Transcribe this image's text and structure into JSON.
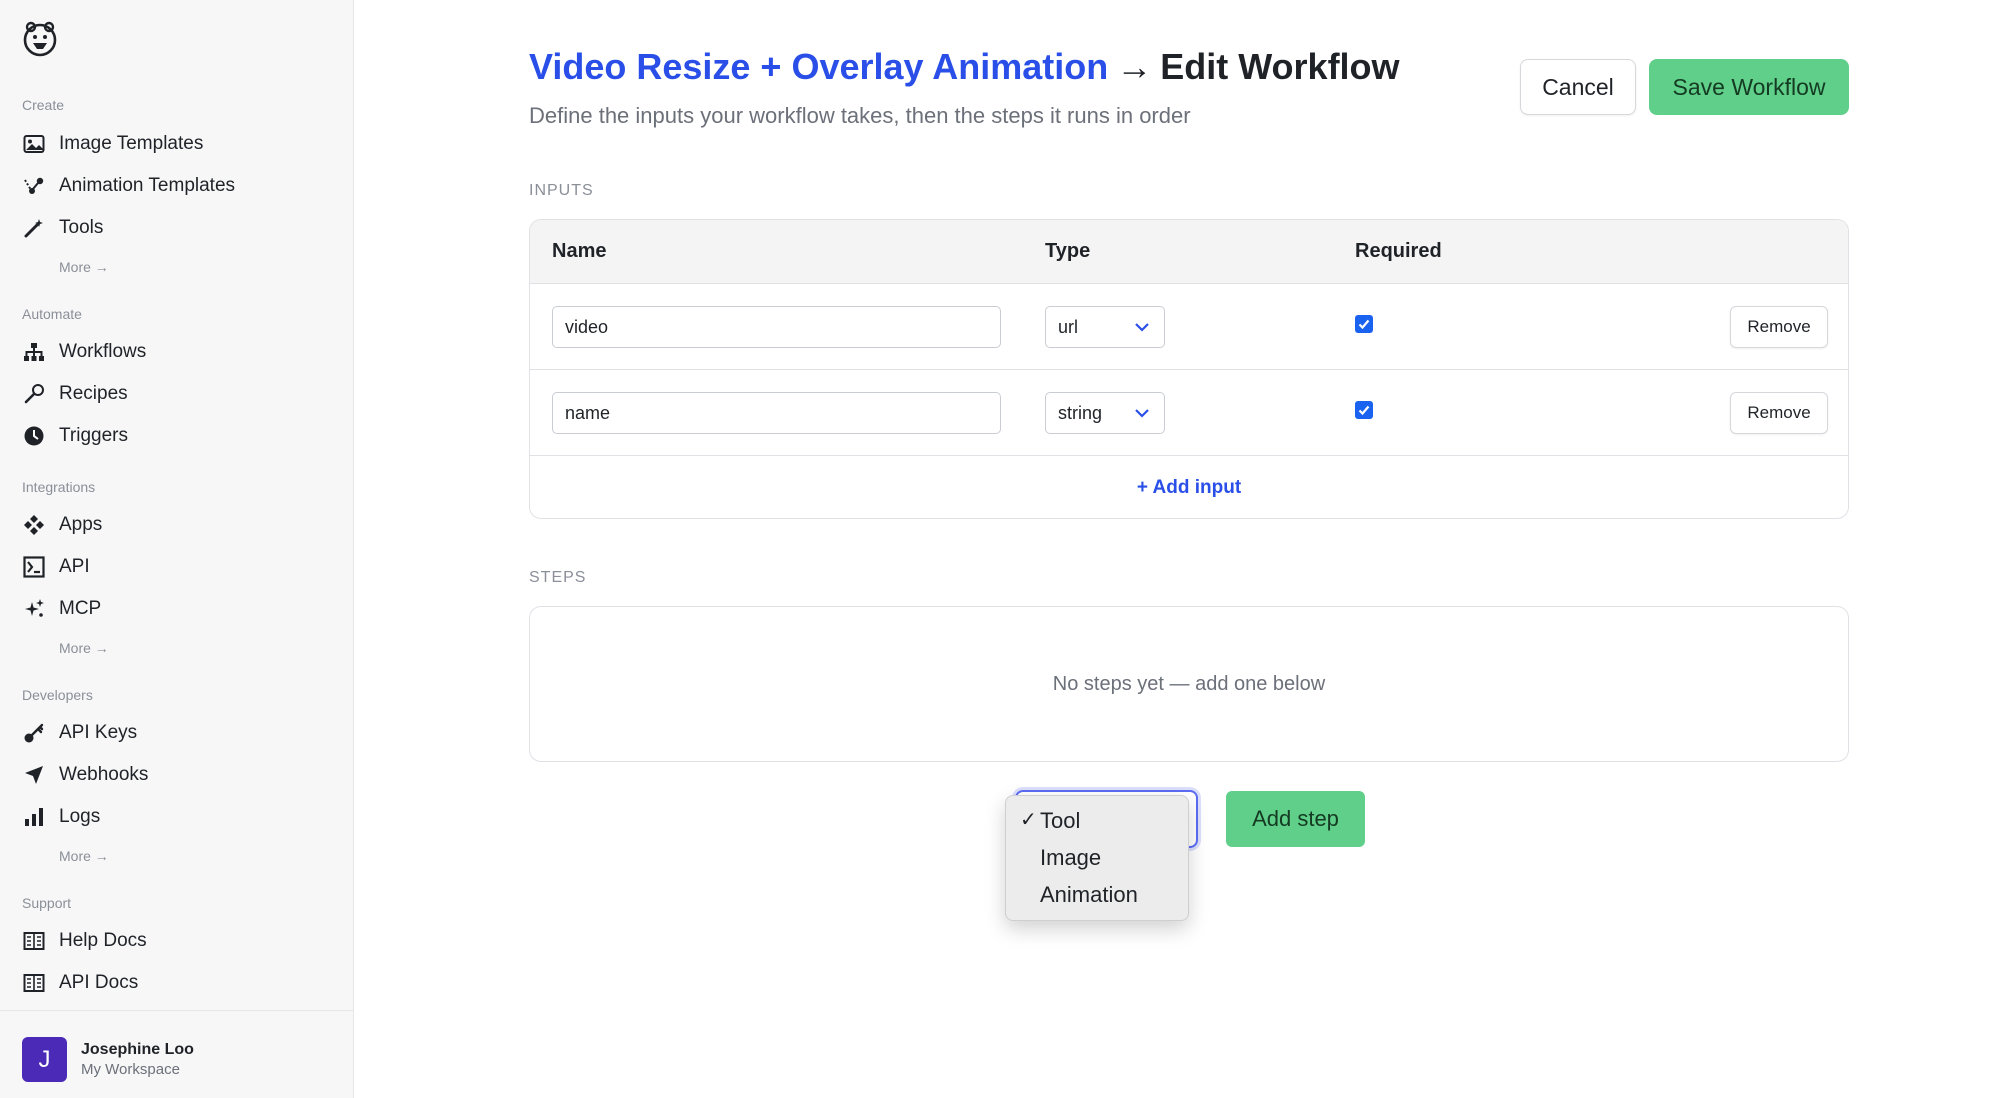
{
  "sidebar": {
    "sections": [
      {
        "label": "Create",
        "items": [
          {
            "label": "Image Templates",
            "icon": "image-icon"
          },
          {
            "label": "Animation Templates",
            "icon": "animation-icon"
          },
          {
            "label": "Tools",
            "icon": "magic-wand-icon"
          }
        ],
        "more": "More →"
      },
      {
        "label": "Automate",
        "items": [
          {
            "label": "Workflows",
            "icon": "workflow-icon"
          },
          {
            "label": "Recipes",
            "icon": "recipe-icon"
          },
          {
            "label": "Triggers",
            "icon": "clock-icon"
          }
        ]
      },
      {
        "label": "Integrations",
        "items": [
          {
            "label": "Apps",
            "icon": "apps-icon"
          },
          {
            "label": "API",
            "icon": "terminal-icon"
          },
          {
            "label": "MCP",
            "icon": "sparkle-icon"
          }
        ],
        "more": "More →"
      },
      {
        "label": "Developers",
        "items": [
          {
            "label": "API Keys",
            "icon": "key-icon"
          },
          {
            "label": "Webhooks",
            "icon": "send-icon"
          },
          {
            "label": "Logs",
            "icon": "bar-chart-icon"
          }
        ],
        "more": "More →"
      },
      {
        "label": "Support",
        "items": [
          {
            "label": "Help Docs",
            "icon": "book-icon"
          },
          {
            "label": "API Docs",
            "icon": "book-icon"
          }
        ]
      }
    ],
    "user": {
      "initial": "J",
      "name": "Josephine Loo",
      "workspace": "My Workspace"
    }
  },
  "header": {
    "breadcrumb": "Video Resize + Overlay Animation",
    "separator": "→",
    "title": "Edit Workflow",
    "subtitle": "Define the inputs your workflow takes, then the steps it runs in order",
    "cancel_label": "Cancel",
    "save_label": "Save Workflow"
  },
  "inputs": {
    "section_label": "INPUTS",
    "columns": [
      "Name",
      "Type",
      "Required"
    ],
    "rows": [
      {
        "name": "video",
        "type": "url",
        "required": true,
        "remove_label": "Remove"
      },
      {
        "name": "name",
        "type": "string",
        "required": true,
        "remove_label": "Remove"
      }
    ],
    "add_label": "+ Add input"
  },
  "steps": {
    "section_label": "STEPS",
    "empty_text": "No steps yet — add one below",
    "add_step_label": "Add step",
    "dropdown": {
      "selected": "Tool",
      "check_mark": "✓",
      "options": [
        "Tool",
        "Image",
        "Animation"
      ]
    }
  },
  "colors": {
    "accent_blue": "#2a4fe8",
    "save_green": "#5fcf8a",
    "avatar_purple": "#4b2ab8",
    "checkbox_blue": "#1a63f0"
  }
}
